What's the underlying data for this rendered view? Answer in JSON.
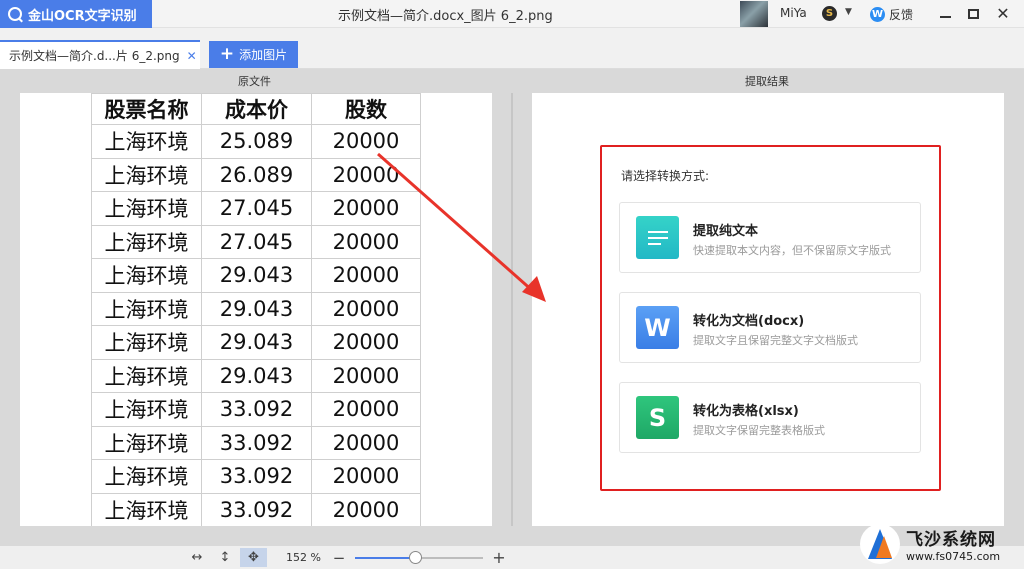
{
  "app": {
    "name": "金山OCR文字识别"
  },
  "window": {
    "doc_title": "示例文档—简介.docx_图片 6_2.png"
  },
  "user": {
    "name": "MiYa",
    "vip_badge": "S"
  },
  "toolbar": {
    "feedback_label": "反馈",
    "feedback_icon": "W"
  },
  "tabs": {
    "file_tab_label": "示例文档—简介.d...片 6_2.png",
    "add_image_label": "添加图片"
  },
  "panes": {
    "source_label": "原文件",
    "result_label": "提取结果"
  },
  "source_table": {
    "headers": [
      "股票名称",
      "成本价",
      "股数"
    ],
    "rows": [
      [
        "上海环境",
        "25.089",
        "20000"
      ],
      [
        "上海环境",
        "26.089",
        "20000"
      ],
      [
        "上海环境",
        "27.045",
        "20000"
      ],
      [
        "上海环境",
        "27.045",
        "20000"
      ],
      [
        "上海环境",
        "29.043",
        "20000"
      ],
      [
        "上海环境",
        "29.043",
        "20000"
      ],
      [
        "上海环境",
        "29.043",
        "20000"
      ],
      [
        "上海环境",
        "29.043",
        "20000"
      ],
      [
        "上海环境",
        "33.092",
        "20000"
      ],
      [
        "上海环境",
        "33.092",
        "20000"
      ],
      [
        "上海环境",
        "33.092",
        "20000"
      ],
      [
        "上海环境",
        "33.092",
        "20000"
      ]
    ]
  },
  "conversion": {
    "prompt": "请选择转换方式:",
    "options": [
      {
        "title": "提取纯文本",
        "desc": "快速提取本文内容，但不保留原文字版式"
      },
      {
        "title": "转化为文档(docx)",
        "desc": "提取文字且保留完整文字文档版式",
        "icon_letter": "W"
      },
      {
        "title": "转化为表格(xlsx)",
        "desc": "提取文字保留完整表格版式",
        "icon_letter": "S"
      }
    ]
  },
  "zoom": {
    "label": "152 %",
    "level_fraction": 0.48
  },
  "watermark": {
    "name": "飞沙系统网",
    "url": "www.fs0745.com"
  },
  "colors": {
    "accent": "#4a7de8",
    "highlight_red": "#e02020"
  }
}
